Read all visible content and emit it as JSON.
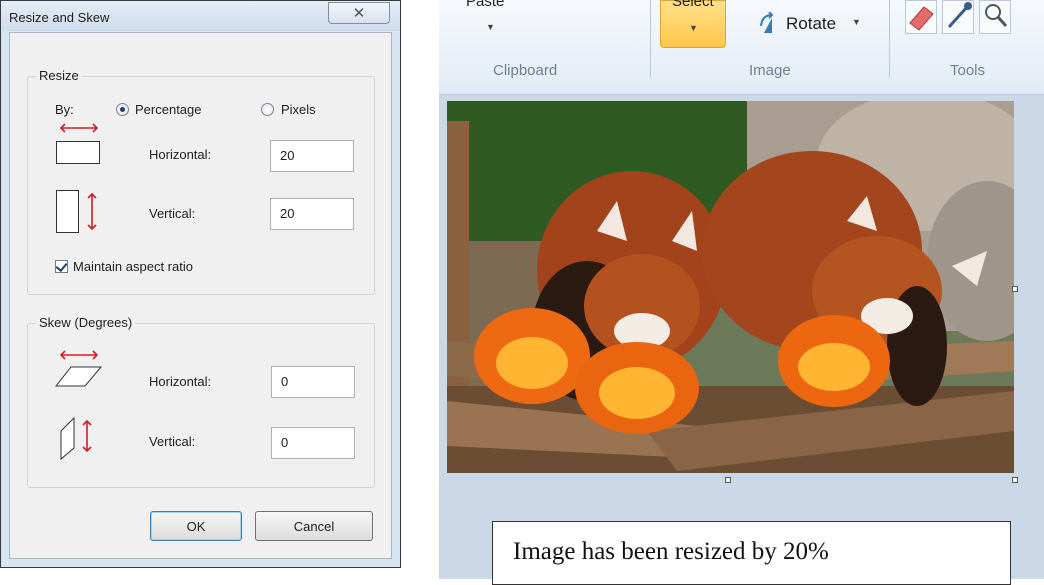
{
  "dialog": {
    "title": "Resize and Skew",
    "resize": {
      "legend": "Resize",
      "by_label": "By:",
      "percentage_label": "Percentage",
      "pixels_label": "Pixels",
      "selected_mode": "Percentage",
      "horizontal_label": "Horizontal:",
      "horizontal_value": "20",
      "vertical_label": "Vertical:",
      "vertical_value": "20",
      "maintain_label": "Maintain aspect ratio",
      "maintain_checked": true
    },
    "skew": {
      "legend": "Skew (Degrees)",
      "horizontal_label": "Horizontal:",
      "horizontal_value": "0",
      "vertical_label": "Vertical:",
      "vertical_value": "0"
    },
    "ok_label": "OK",
    "cancel_label": "Cancel",
    "icons": {
      "close": "close-icon",
      "resize_horizontal": "resize-horizontal-icon",
      "resize_vertical": "resize-vertical-icon",
      "skew_horizontal": "skew-horizontal-icon",
      "skew_vertical": "skew-vertical-icon"
    }
  },
  "paint": {
    "ribbon": {
      "paste_label": "Paste",
      "select_label": "Select",
      "rotate_label": "Rotate",
      "groups": [
        "Clipboard",
        "Image",
        "Tools"
      ]
    },
    "caption": "Image has been resized by 20%",
    "colors": {
      "select_highlight": "#ffc74b",
      "arrow_red": "#d21e1e",
      "canvas_bg": "#cbd8e8"
    }
  }
}
